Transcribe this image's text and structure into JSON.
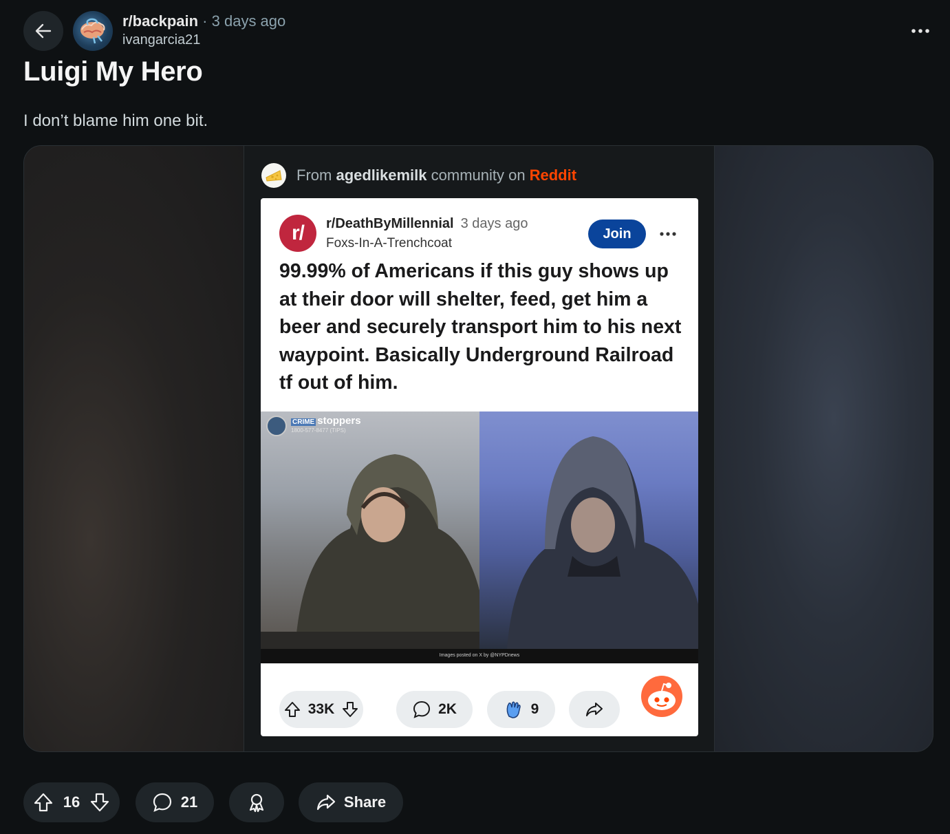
{
  "post": {
    "subreddit": "r/backpain",
    "separator": "·",
    "time": "3 days ago",
    "author": "ivangarcia21",
    "title": "Luigi My Hero",
    "body": "I don’t blame him one bit."
  },
  "embed": {
    "source_prefix": "From",
    "source_community": "agedlikemilk",
    "source_middle": "community on",
    "source_platform": "Reddit",
    "card": {
      "sub_icon_text": "r/",
      "subreddit": "r/DeathByMillennial",
      "time": "3 days ago",
      "author": "Foxs-In-A-Trenchcoat",
      "join_label": "Join",
      "title": "99.99% of Americans if this guy shows up at their door will shelter, feed, get him a beer and securely transport him to his next waypoint. Basically Underground Railroad tf out of him.",
      "image_badge_crime": "CRIME",
      "image_badge_title": "stoppers",
      "image_badge_phone": "1800-577-8477 (TIPS)",
      "image_caption": "Images posted on X by @NYPDnews",
      "upvotes": "33K",
      "comments": "2K",
      "awards": "9"
    }
  },
  "footer": {
    "votes": "16",
    "comments": "21",
    "share_label": "Share"
  },
  "colors": {
    "background": "#0e1113",
    "pill": "#1f2529",
    "reddit_orange": "#ff4500",
    "join_blue": "#0a449b",
    "sub_icon_red": "#c0263e"
  },
  "icons": [
    "back-arrow-icon",
    "more-icon",
    "upvote-icon",
    "downvote-icon",
    "comment-icon",
    "award-icon",
    "share-icon",
    "clap-award-icon",
    "snoo-icon",
    "cheese-icon"
  ]
}
